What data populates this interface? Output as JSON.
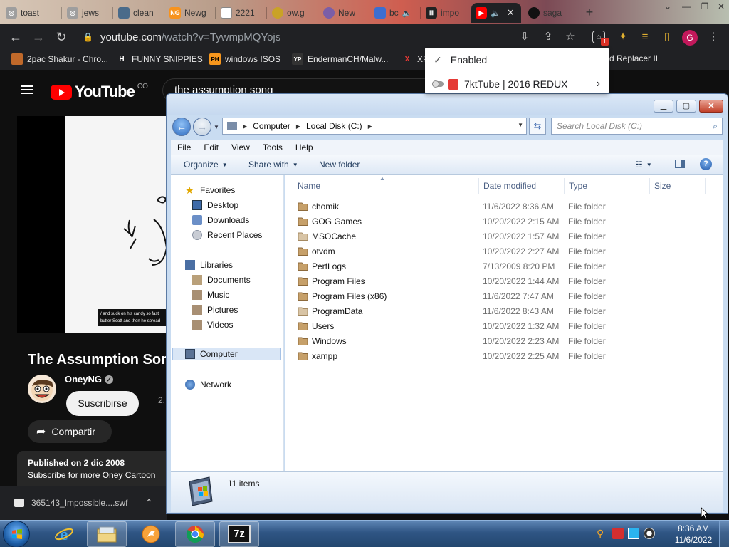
{
  "browser": {
    "tabs": [
      {
        "label": "toast"
      },
      {
        "label": "jews"
      },
      {
        "label": "clean"
      },
      {
        "label": "Newg"
      },
      {
        "label": "2221"
      },
      {
        "label": "ow.g"
      },
      {
        "label": "New"
      },
      {
        "label": "bc"
      },
      {
        "label": "impo"
      },
      {
        "label": ""
      },
      {
        "label": "saga"
      }
    ],
    "new_tab": "+",
    "url_host": "youtube.com",
    "url_path": "/watch?v=TywmpMQYojs",
    "profile_initial": "G",
    "extension_badge": "1",
    "bookmarks": [
      {
        "label": "2pac Shakur - Chro...",
        "icon_text": "",
        "color": "#c0692a"
      },
      {
        "label": "FUNNY SNIPPIES",
        "icon_text": "H",
        "color": "#ffffff"
      },
      {
        "label": "windows ISOS",
        "icon_text": "PH",
        "color": "#f7971d"
      },
      {
        "label": "EndermanCH/Malw...",
        "icon_text": "YP",
        "color": "#333333"
      },
      {
        "label": "XP",
        "icon_text": "X",
        "color": "#e53935"
      },
      {
        "label": "d Replacer II",
        "icon_text": "",
        "color": ""
      }
    ],
    "extension_menu": {
      "enabled_label": "Enabled",
      "item_label": "7ktTube | 2016 REDUX"
    }
  },
  "youtube": {
    "logo_text": "YouTube",
    "logo_region": "CO",
    "search_value": "the assumption song",
    "video_caption": "/ and suck on his candy so fast butter Scott and then he spread",
    "title": "The Assumption Song",
    "channel": "OneyNG",
    "subs_partial": "2.",
    "subscribe_label": "Suscribirse",
    "share_label": "Compartir",
    "published": "Published on 2 dic 2008",
    "description": "Subscribe for more Oney Cartoon",
    "download_file": "365143_Impossible....swf"
  },
  "explorer": {
    "breadcrumb": [
      "Computer",
      "Local Disk (C:)"
    ],
    "search_placeholder": "Search Local Disk (C:)",
    "menus": [
      "File",
      "Edit",
      "View",
      "Tools",
      "Help"
    ],
    "commands": {
      "organize": "Organize",
      "share": "Share with",
      "new_folder": "New folder"
    },
    "nav": {
      "favorites": "Favorites",
      "desktop": "Desktop",
      "downloads": "Downloads",
      "recent": "Recent Places",
      "libraries": "Libraries",
      "documents": "Documents",
      "music": "Music",
      "pictures": "Pictures",
      "videos": "Videos",
      "computer": "Computer",
      "network": "Network"
    },
    "columns": {
      "name": "Name",
      "date": "Date modified",
      "type": "Type",
      "size": "Size"
    },
    "files": [
      {
        "name": "chomik",
        "date": "11/6/2022 8:36 AM",
        "type": "File folder"
      },
      {
        "name": "GOG Games",
        "date": "10/20/2022 2:15 AM",
        "type": "File folder"
      },
      {
        "name": "MSOCache",
        "date": "10/20/2022 1:57 AM",
        "type": "File folder"
      },
      {
        "name": "otvdm",
        "date": "10/20/2022 2:27 AM",
        "type": "File folder"
      },
      {
        "name": "PerfLogs",
        "date": "7/13/2009 8:20 PM",
        "type": "File folder"
      },
      {
        "name": "Program Files",
        "date": "10/20/2022 1:44 AM",
        "type": "File folder"
      },
      {
        "name": "Program Files (x86)",
        "date": "11/6/2022 7:47 AM",
        "type": "File folder"
      },
      {
        "name": "ProgramData",
        "date": "11/6/2022 8:43 AM",
        "type": "File folder"
      },
      {
        "name": "Users",
        "date": "10/20/2022 1:32 AM",
        "type": "File folder"
      },
      {
        "name": "Windows",
        "date": "10/20/2022 2:23 AM",
        "type": "File folder"
      },
      {
        "name": "xampp",
        "date": "10/20/2022 2:25 AM",
        "type": "File folder"
      }
    ],
    "item_count": "11 items"
  },
  "taskbar": {
    "time": "8:36 AM",
    "date": "11/6/2022",
    "sevenzip_label": "7z"
  }
}
